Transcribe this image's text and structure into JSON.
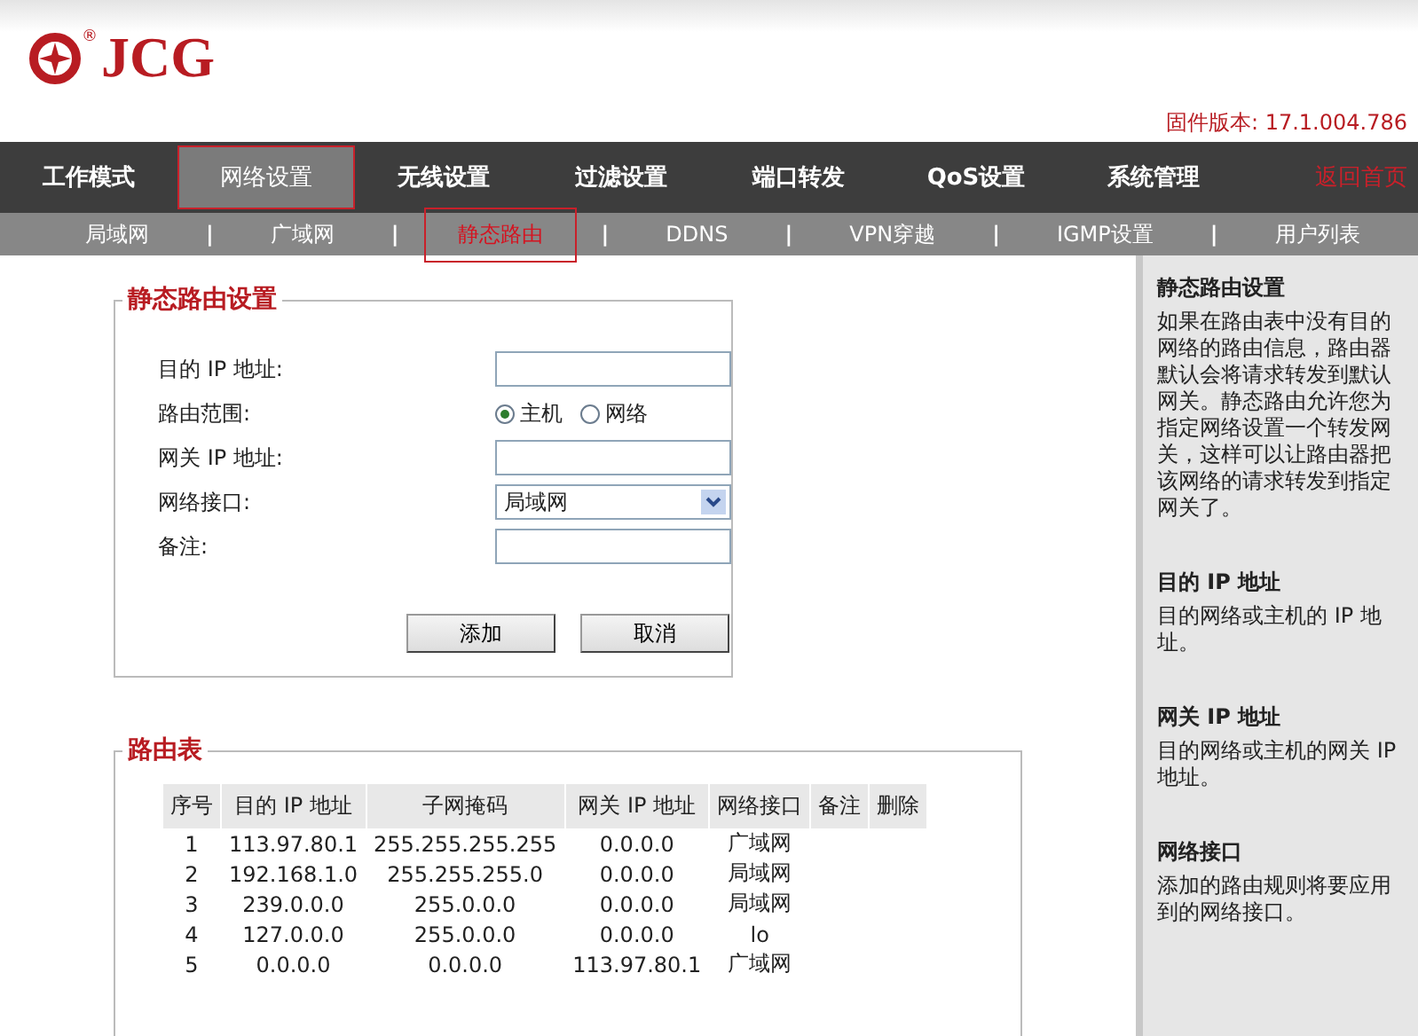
{
  "logo": {
    "text": "JCG",
    "mark": "®"
  },
  "firmware": "固件版本: 17.1.004.786",
  "main_nav": [
    {
      "label": "工作模式",
      "selected": false
    },
    {
      "label": "网络设置",
      "selected": true
    },
    {
      "label": "无线设置",
      "selected": false
    },
    {
      "label": "过滤设置",
      "selected": false
    },
    {
      "label": "端口转发",
      "selected": false
    },
    {
      "label": "QoS设置",
      "selected": false
    },
    {
      "label": "系统管理",
      "selected": false
    }
  ],
  "home_link": "返回首页",
  "sub_nav": [
    {
      "label": "局域网",
      "selected": false
    },
    {
      "label": "广域网",
      "selected": false
    },
    {
      "label": "静态路由",
      "selected": true
    },
    {
      "label": "DDNS",
      "selected": false
    },
    {
      "label": "VPN穿越",
      "selected": false
    },
    {
      "label": "IGMP设置",
      "selected": false
    },
    {
      "label": "用户列表",
      "selected": false
    }
  ],
  "sub_nav_separator": "|",
  "form": {
    "title": "静态路由设置",
    "fields": [
      {
        "kind": "text",
        "label": "目的 IP 地址:"
      },
      {
        "kind": "radio",
        "label": "路由范围:",
        "options": [
          {
            "label": "主机",
            "selected": true
          },
          {
            "label": "网络",
            "selected": false
          }
        ]
      },
      {
        "kind": "text",
        "label": "网关 IP 地址:"
      },
      {
        "kind": "select",
        "label": "网络接口:",
        "value": "局域网"
      },
      {
        "kind": "text",
        "label": "备注:"
      }
    ],
    "buttons": [
      "添加",
      "取消"
    ]
  },
  "route_table": {
    "title": "路由表",
    "columns": [
      "序号",
      "目的 IP 地址",
      "子网掩码",
      "网关 IP 地址",
      "网络接口",
      "备注",
      "删除"
    ],
    "rows": [
      [
        "1",
        "113.97.80.1",
        "255.255.255.255",
        "0.0.0.0",
        "广域网"
      ],
      [
        "2",
        "192.168.1.0",
        "255.255.255.0",
        "0.0.0.0",
        "局域网"
      ],
      [
        "3",
        "239.0.0.0",
        "255.0.0.0",
        "0.0.0.0",
        "局域网"
      ],
      [
        "4",
        "127.0.0.0",
        "255.0.0.0",
        "0.0.0.0",
        "lo"
      ],
      [
        "5",
        "0.0.0.0",
        "0.0.0.0",
        "113.97.80.1",
        "广域网"
      ]
    ]
  },
  "help": [
    {
      "title": "静态路由设置",
      "text": "如果在路由表中没有目的网络的路由信息，路由器默认会将请求转发到默认网关。静态路由允许您为指定网络设置一个转发网关，这样可以让路由器把该网络的请求转发到指定网关了。"
    },
    {
      "title": "目的 IP 地址",
      "text": "目的网络或主机的 IP 地址。"
    },
    {
      "title": "网关 IP 地址",
      "text": "目的网络或主机的网关 IP 地址。"
    },
    {
      "title": "网络接口",
      "text": "添加的路由规则将要应用到的网络接口。"
    }
  ]
}
